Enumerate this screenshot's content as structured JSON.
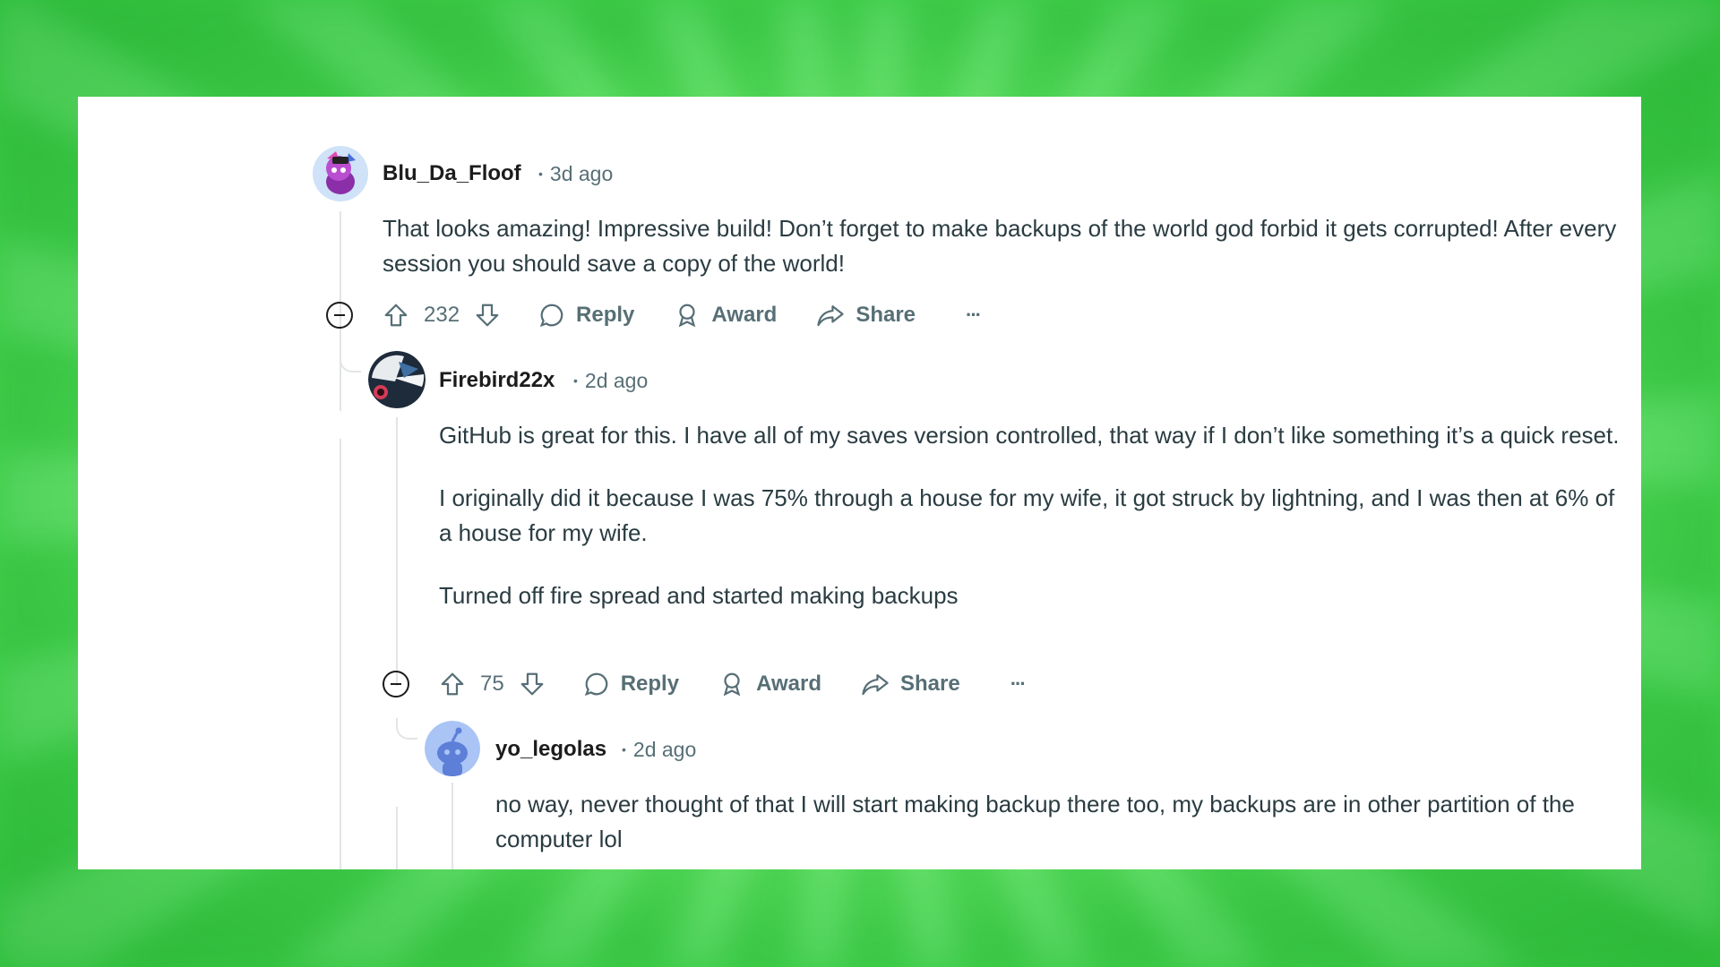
{
  "comments": [
    {
      "username": "Blu_Da_Floof",
      "time": "3d ago",
      "body": [
        "That looks amazing! Impressive build! Don’t forget to make backups of the world god forbid it gets corrupted! After every session you should save a copy of the world!"
      ],
      "score": "232",
      "reply_label": "Reply",
      "award_label": "Award",
      "share_label": "Share"
    },
    {
      "username": "Firebird22x",
      "time": "2d ago",
      "body": [
        "GitHub is great for this. I have all of my saves version controlled, that way if I don’t like something it’s a quick reset.",
        "I originally did it because I was 75% through a house for my wife, it got struck by lightning, and I was then at 6% of a house for my wife.",
        "Turned off fire spread and started making backups"
      ],
      "score": "75",
      "reply_label": "Reply",
      "award_label": "Award",
      "share_label": "Share"
    },
    {
      "username": "yo_legolas",
      "time": "2d ago",
      "body": [
        "no way, never thought of that I will start making backup there too, my backups are in other partition of the computer lol"
      ]
    }
  ],
  "separator": "•",
  "more_glyph": "···",
  "colors": {
    "accent_bg": "#6ff06f",
    "muted": "#576f76",
    "text": "#2a3c42"
  }
}
